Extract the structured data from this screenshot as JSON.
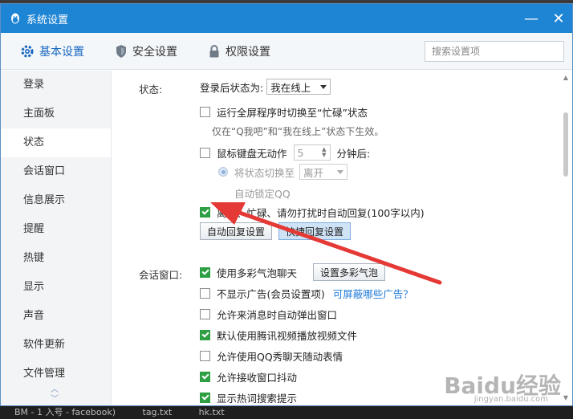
{
  "window": {
    "title": "系统设置",
    "minimize": "—",
    "close": "✕"
  },
  "tabs": [
    {
      "label": "基本设置",
      "icon": "gear-icon"
    },
    {
      "label": "安全设置",
      "icon": "shield-icon"
    },
    {
      "label": "权限设置",
      "icon": "lock-icon"
    }
  ],
  "search": {
    "placeholder": "搜索设置项"
  },
  "sidebar": {
    "items": [
      "登录",
      "主面板",
      "状态",
      "会话窗口",
      "信息展示",
      "提醒",
      "热键",
      "显示",
      "声音",
      "软件更新",
      "文件管理"
    ],
    "active": "状态"
  },
  "status_section": {
    "label": "状态:",
    "login_status_label": "登录后状态为:",
    "login_status_value": "我在线上",
    "fullscreen_busy": "运行全屏程序时切换至“忙碌”状态",
    "fullscreen_hint": "仅在“Q我吧”和“我在线上”状态下生效。",
    "idle_label": "鼠标键盘无动作",
    "idle_minutes": "5",
    "idle_suffix": "分钟后:",
    "switch_to_label": "将状态切换至",
    "switch_to_value": "离开",
    "auto_lock": "自动锁定QQ",
    "auto_reply": "离开、忙碌、请勿打扰时自动回复(100字以内)",
    "auto_reply_btn": "自动回复设置",
    "quick_reply_btn": "快捷回复设置"
  },
  "chat_section": {
    "label": "会话窗口:",
    "bubble": "使用多彩气泡聊天",
    "bubble_btn": "设置多彩气泡",
    "no_ads": "不显示广告(会员设置项)",
    "ads_link": "可屏蔽哪些广告？",
    "popup": "允许来消息时自动弹出窗口",
    "tencent_video": "默认使用腾讯视频播放视频文件",
    "qq_show": "允许使用QQ秀聊天随动表情",
    "shake": "允许接收窗口抖动",
    "hot_search": "显示热词搜索提示"
  },
  "taskbar": {
    "items": [
      "BM - 1 入号 - facebook)",
      "tag.txt",
      "hk.txt"
    ]
  },
  "watermark": {
    "main": "Baidu经验",
    "sub": "jingyan.baidu.com"
  },
  "colors": {
    "titlebar": "#1e84d4",
    "accent": "#1565c0",
    "checkbox": "#2ea043",
    "arrow": "#e53935"
  }
}
